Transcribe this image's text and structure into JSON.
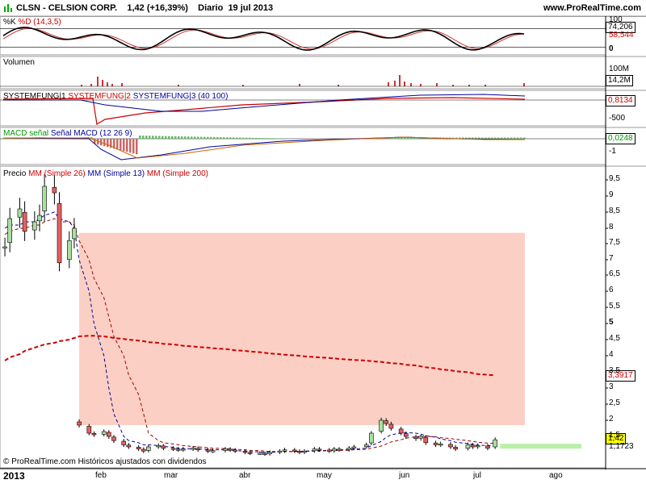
{
  "header": {
    "symbol": "CLSN",
    "company": "CELSION CORP.",
    "price": "1,42",
    "change": "(+16,39%)",
    "period": "Diario",
    "date": "19 jul 2013",
    "site": "www.ProRealTime.com"
  },
  "panels": {
    "stoch": {
      "label_k": "%K",
      "label_d": "%D",
      "params": "(14,3,5)",
      "axis": [
        "100",
        "0"
      ],
      "value_k": "74,206",
      "value_d": "58,544"
    },
    "volume": {
      "label": "Volumen",
      "axis": [
        "100M"
      ],
      "value": "14,2M"
    },
    "system": {
      "label_1": "SYSTEMFUNG|1",
      "label_2": "SYSTEMFUNG|2",
      "label_3": "SYSTEMFUNG|3",
      "params": "(40 100)",
      "axis": [
        "-500"
      ],
      "value": "0,8134"
    },
    "macd": {
      "label_1": "MACD",
      "label_2": "señal",
      "label_3": "Señal MACD",
      "params": "(12 26 9)",
      "axis": [
        "-1"
      ],
      "value": "0,0248"
    },
    "price": {
      "label": "Precio",
      "ma1": "MM (Simple 26)",
      "ma2": "MM (Simple 13)",
      "ma3": "MM (Simple 200)",
      "axis": [
        "9,5",
        "9",
        "8,5",
        "8",
        "7,5",
        "7",
        "6,5",
        "6",
        "5,5",
        "5",
        "4,5",
        "4",
        "3,5",
        "3",
        "2,5",
        "2",
        "1,5"
      ],
      "value_ma200": "3,3917",
      "value_price": "1,42",
      "value_ma": "1,1723"
    }
  },
  "xaxis": {
    "year": "2013",
    "months": [
      "feb",
      "mar",
      "abr",
      "may",
      "jun",
      "jul",
      "ago"
    ]
  },
  "footer": "© ProRealTime.com Históricos ajustados con dividendos",
  "colors": {
    "up": "#a8e0a0",
    "down": "#e86060",
    "zone": "#fccfc4",
    "ma200": "#cc0000",
    "ma13": "#000099",
    "ma26": "#990000"
  },
  "chart_data": {
    "type": "candlestick",
    "title": "CLSN - CELSION CORP.",
    "ylim": [
      1.0,
      9.8
    ],
    "x": [
      "2013-01-02",
      "2013-01-04",
      "2013-01-08",
      "2013-01-10",
      "2013-01-14",
      "2013-01-16",
      "2013-01-18",
      "2013-01-22",
      "2013-01-24",
      "2013-01-28",
      "2013-01-30",
      "2013-02-01",
      "2013-02-05",
      "2013-02-07",
      "2013-02-11",
      "2013-02-13",
      "2013-02-15",
      "2013-02-19",
      "2013-02-21",
      "2013-02-25",
      "2013-02-27",
      "2013-03-01",
      "2013-03-05",
      "2013-03-07",
      "2013-03-11",
      "2013-03-13",
      "2013-03-15",
      "2013-03-19",
      "2013-03-21",
      "2013-03-25",
      "2013-03-27",
      "2013-04-01",
      "2013-04-03",
      "2013-04-05",
      "2013-04-09",
      "2013-04-11",
      "2013-04-15",
      "2013-04-17",
      "2013-04-19",
      "2013-04-23",
      "2013-04-25",
      "2013-04-29",
      "2013-05-01",
      "2013-05-03",
      "2013-05-07",
      "2013-05-09",
      "2013-05-13",
      "2013-05-15",
      "2013-05-17",
      "2013-05-21",
      "2013-05-23",
      "2013-05-28",
      "2013-05-30",
      "2013-06-03",
      "2013-06-05",
      "2013-06-07",
      "2013-06-11",
      "2013-06-13",
      "2013-06-17",
      "2013-06-19",
      "2013-06-21",
      "2013-06-25",
      "2013-06-27",
      "2013-07-01",
      "2013-07-03",
      "2013-07-08",
      "2013-07-10",
      "2013-07-12",
      "2013-07-16",
      "2013-07-19"
    ],
    "close": [
      7.4,
      8.3,
      8.6,
      7.9,
      8.2,
      8.4,
      9.3,
      9.1,
      6.9,
      7.6,
      8.0,
      1.85,
      1.6,
      1.55,
      1.65,
      1.5,
      1.4,
      1.3,
      1.25,
      1.2,
      1.15,
      1.25,
      1.28,
      1.22,
      1.2,
      1.18,
      1.2,
      1.22,
      1.18,
      1.15,
      1.16,
      1.2,
      1.18,
      1.15,
      1.12,
      1.1,
      1.1,
      1.08,
      1.12,
      1.15,
      1.18,
      1.15,
      1.12,
      1.15,
      1.2,
      1.18,
      1.15,
      1.2,
      1.18,
      1.22,
      1.25,
      1.3,
      1.6,
      2.0,
      1.9,
      1.75,
      1.6,
      1.5,
      1.45,
      1.5,
      1.35,
      1.3,
      1.32,
      1.25,
      1.2,
      1.3,
      1.25,
      1.28,
      1.22,
      1.42
    ],
    "series": [
      {
        "name": "MM (Simple 200)",
        "values": [
          3.85,
          3.95,
          4.05,
          4.15,
          4.25,
          4.3,
          4.35,
          4.4,
          4.45,
          4.5,
          4.55,
          4.6,
          4.62,
          4.62,
          4.6,
          4.58,
          4.55,
          4.52,
          4.5,
          4.47,
          4.45,
          4.42,
          4.4,
          4.37,
          4.35,
          4.33,
          4.31,
          4.29,
          4.27,
          4.25,
          4.23,
          4.21,
          4.19,
          4.17,
          4.15,
          4.13,
          4.11,
          4.09,
          4.07,
          4.05,
          4.03,
          4.01,
          4.0,
          3.98,
          3.96,
          3.95,
          3.93,
          3.92,
          3.9,
          3.88,
          3.87,
          3.85,
          3.83,
          3.81,
          3.79,
          3.77,
          3.75,
          3.72,
          3.7,
          3.67,
          3.64,
          3.61,
          3.58,
          3.55,
          3.52,
          3.49,
          3.46,
          3.43,
          3.41,
          3.39
        ]
      },
      {
        "name": "MM (Simple 13)",
        "values": [
          8.0,
          8.1,
          8.1,
          8.2,
          8.2,
          8.3,
          8.4,
          8.5,
          8.3,
          8.2,
          8.0,
          7.0,
          6.0,
          5.0,
          4.0,
          3.0,
          2.2,
          1.5,
          1.4,
          1.35,
          1.3,
          1.3,
          1.28,
          1.26,
          1.24,
          1.22,
          1.21,
          1.2,
          1.2,
          1.19,
          1.18,
          1.18,
          1.17,
          1.16,
          1.15,
          1.14,
          1.13,
          1.12,
          1.12,
          1.13,
          1.14,
          1.14,
          1.14,
          1.15,
          1.16,
          1.16,
          1.17,
          1.18,
          1.18,
          1.19,
          1.2,
          1.22,
          1.28,
          1.38,
          1.48,
          1.55,
          1.6,
          1.62,
          1.6,
          1.57,
          1.52,
          1.48,
          1.44,
          1.4,
          1.36,
          1.33,
          1.31,
          1.29,
          1.28,
          1.29
        ]
      },
      {
        "name": "MM (Simple 26)",
        "values": [
          7.8,
          7.9,
          8.0,
          8.0,
          8.1,
          8.1,
          8.2,
          8.3,
          8.2,
          8.2,
          8.1,
          7.6,
          7.0,
          6.4,
          5.8,
          5.2,
          4.6,
          4.0,
          3.4,
          2.8,
          2.2,
          1.6,
          1.4,
          1.35,
          1.32,
          1.3,
          1.28,
          1.26,
          1.25,
          1.23,
          1.22,
          1.21,
          1.2,
          1.19,
          1.18,
          1.17,
          1.16,
          1.15,
          1.14,
          1.14,
          1.14,
          1.14,
          1.14,
          1.14,
          1.15,
          1.15,
          1.16,
          1.16,
          1.17,
          1.17,
          1.18,
          1.19,
          1.22,
          1.27,
          1.32,
          1.37,
          1.42,
          1.46,
          1.49,
          1.5,
          1.5,
          1.49,
          1.47,
          1.45,
          1.43,
          1.4,
          1.38,
          1.36,
          1.34,
          1.33
        ]
      }
    ],
    "zone": {
      "from": "2013-02-01",
      "to": "2013-07-31",
      "ymin": 1.85,
      "ymax": 7.85
    }
  }
}
